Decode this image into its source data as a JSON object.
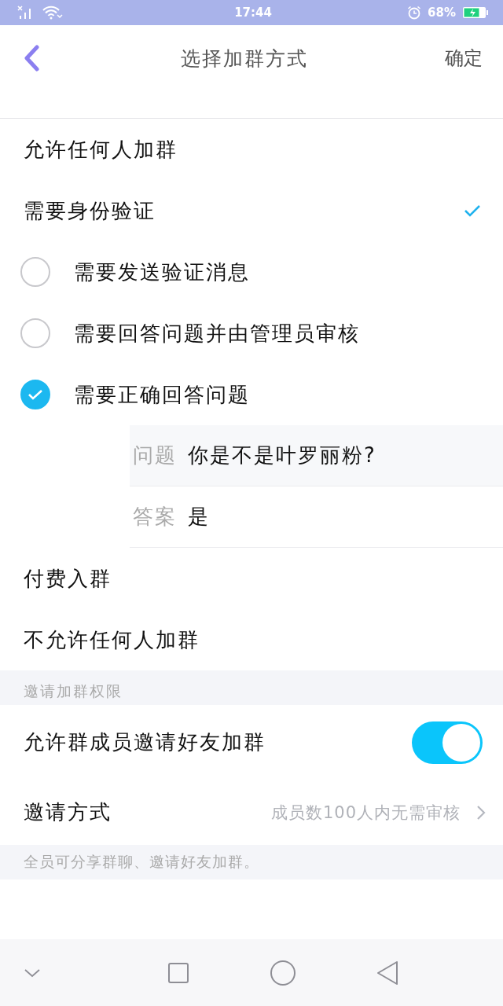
{
  "status_bar": {
    "time": "17:44",
    "battery": "68%"
  },
  "header": {
    "title": "选择加群方式",
    "confirm": "确定"
  },
  "options": [
    {
      "label": "允许任何人加群",
      "selected": false
    },
    {
      "label": "需要身份验证",
      "selected": true,
      "methods": [
        {
          "label": "需要发送验证消息",
          "selected": false
        },
        {
          "label": "需要回答问题并由管理员审核",
          "selected": false
        },
        {
          "label": "需要正确回答问题",
          "selected": true,
          "fields": [
            {
              "label": "问题",
              "value": "你是不是叶罗丽粉?"
            },
            {
              "label": "答案",
              "value": "是"
            }
          ]
        }
      ]
    },
    {
      "label": "付费入群",
      "selected": false
    },
    {
      "label": "不允许任何人加群",
      "selected": false
    }
  ],
  "invite": {
    "header": "邀请加群权限",
    "toggle": {
      "label": "允许群成员邀请好友加群",
      "on": true
    },
    "method": {
      "label": "邀请方式",
      "value": "成员数100人内无需审核"
    },
    "note": "全员可分享群聊、邀请好友加群。"
  }
}
